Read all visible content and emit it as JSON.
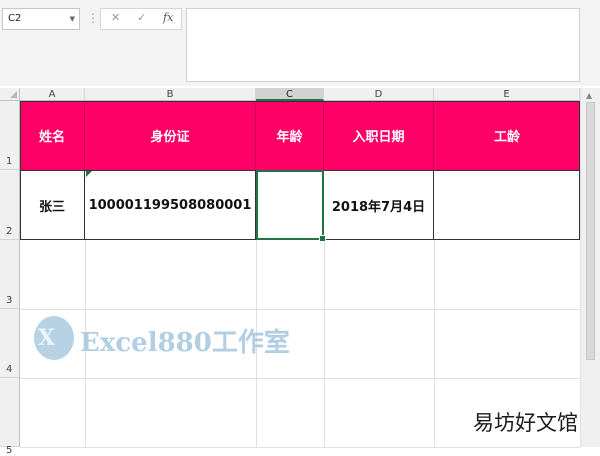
{
  "formula_bar": {
    "name_box": "C2",
    "cancel_glyph": "✕",
    "enter_glyph": "✓",
    "fx_label": "fx",
    "formula_value": ""
  },
  "columns": [
    "A",
    "B",
    "C",
    "D",
    "E"
  ],
  "selected_column": "C",
  "rows": [
    "1",
    "2",
    "3",
    "4",
    "5"
  ],
  "table": {
    "headers": [
      "姓名",
      "身份证",
      "年龄",
      "入职日期",
      "工龄"
    ],
    "row2": [
      "张三",
      "100001199508080001",
      "",
      "2018年7月4日",
      ""
    ]
  },
  "selected_cell": "C2",
  "colors": {
    "header_fill": "#ff0066",
    "header_text": "#ffffff",
    "selection": "#217346"
  },
  "watermarks": {
    "logo_glyph": "X",
    "brand": "Excel880工作室",
    "corner": "易坊好文馆"
  }
}
